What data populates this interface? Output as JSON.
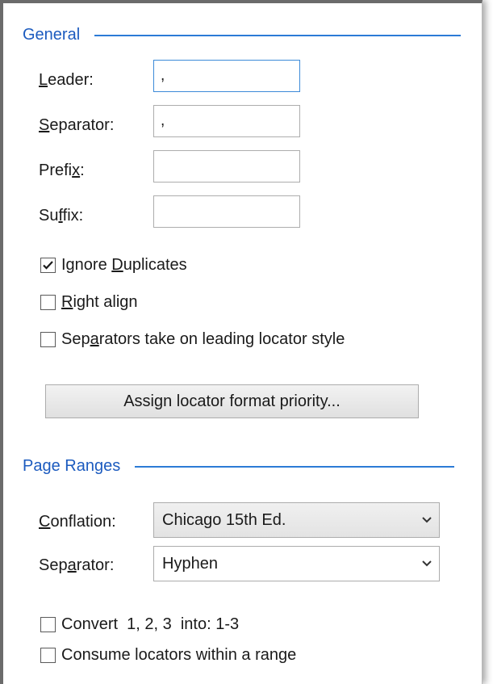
{
  "general": {
    "header": "General",
    "leader": {
      "label_pre": "",
      "label_key": "L",
      "label_post": "eader:",
      "value": ","
    },
    "separator": {
      "label_pre": "",
      "label_key": "S",
      "label_post": "eparator:",
      "value": ","
    },
    "prefix": {
      "label_pre": "Prefi",
      "label_key": "x",
      "label_post": ":",
      "value": ""
    },
    "suffix": {
      "label_pre": "Su",
      "label_key": "f",
      "label_post": "fix:",
      "value": ""
    },
    "ignore_duplicates": {
      "label_pre": "Ignore ",
      "label_key": "D",
      "label_post": "uplicates",
      "checked": true
    },
    "right_align": {
      "label_pre": "",
      "label_key": "R",
      "label_post": "ight align",
      "checked": false
    },
    "separators_style": {
      "label_pre": "Sep",
      "label_key": "a",
      "label_post": "rators take on leading locator style",
      "checked": false
    },
    "assign_button": "Assign locator format priority..."
  },
  "page_ranges": {
    "header": "Page Ranges",
    "conflation": {
      "label_pre": "",
      "label_key": "C",
      "label_post": "onflation:",
      "value": "Chicago 15th Ed."
    },
    "separator": {
      "label_pre": "Sep",
      "label_key": "a",
      "label_post": "rator:",
      "value": "Hyphen"
    },
    "convert": {
      "label": "Convert  1, 2, 3  into: 1-3",
      "checked": false
    },
    "consume": {
      "label": "Consume locators within a range",
      "checked": false
    }
  },
  "colors": {
    "header_text": "#1c5bbf",
    "header_rule": "#2c7bd6",
    "focus_border": "#3c8ad8"
  },
  "icons": {
    "checkmark": "checkmark-icon",
    "dropdown": "chevron-down-icon"
  }
}
